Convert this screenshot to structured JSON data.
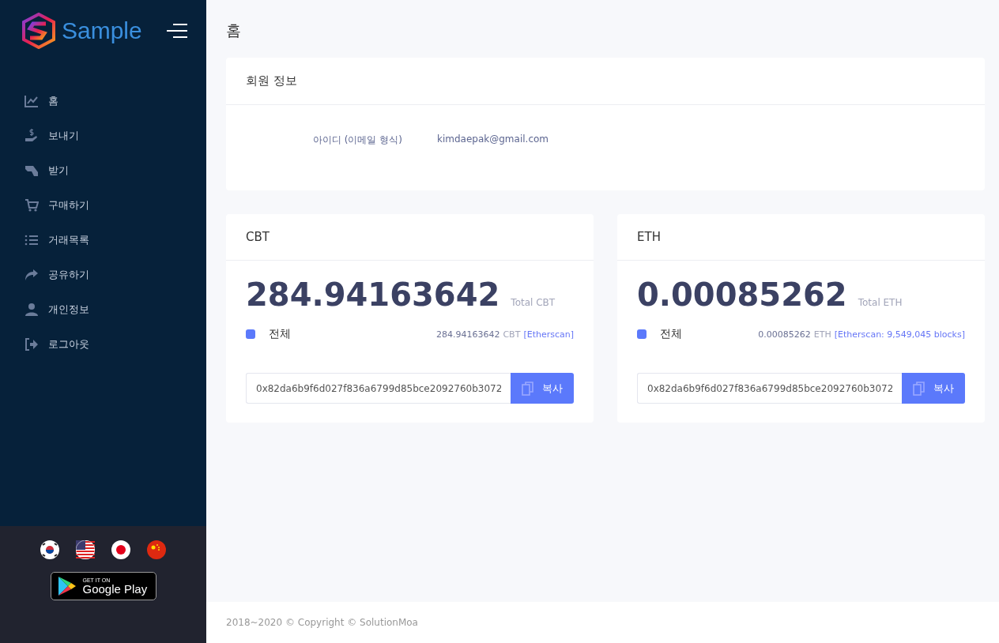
{
  "brand": {
    "name": "Sample"
  },
  "sidebar": {
    "items": [
      {
        "label": "홈"
      },
      {
        "label": "보내기"
      },
      {
        "label": "받기"
      },
      {
        "label": "구매하기"
      },
      {
        "label": "거래목록"
      },
      {
        "label": "공유하기"
      },
      {
        "label": "개인정보"
      },
      {
        "label": "로그아웃"
      }
    ],
    "languages": [
      {
        "kind": "kr"
      },
      {
        "kind": "us"
      },
      {
        "kind": "jp"
      },
      {
        "kind": "cn"
      }
    ],
    "store_badge": {
      "small": "GET IT ON",
      "big": "Google Play"
    }
  },
  "page_title": "홈",
  "member": {
    "title": "회원 정보",
    "label": "아이디 (이메일 형식)",
    "value": "kimdaepak@gmail.com"
  },
  "wallets": [
    {
      "title": "CBT",
      "amount": "284.94163642",
      "total_label": "Total CBT",
      "legend": "전체",
      "color": "#5b79fb",
      "balance": "284.94163642",
      "unit": "CBT",
      "link": "[Etherscan]",
      "address": "0x82da6b9f6d027f836a6799d85bce2092760b3072",
      "button": "복사"
    },
    {
      "title": "ETH",
      "amount": "0.00085262",
      "total_label": "Total ETH",
      "legend": "전체",
      "color": "#5b79fb",
      "balance": "0.00085262",
      "unit": "ETH",
      "link": "[Etherscan: 9,549,045 blocks]",
      "address": "0x82da6b9f6d027f836a6799d85bce2092760b3072",
      "button": "복사"
    }
  ],
  "footer": "2018~2020 © Copyright © SolutionMoa"
}
